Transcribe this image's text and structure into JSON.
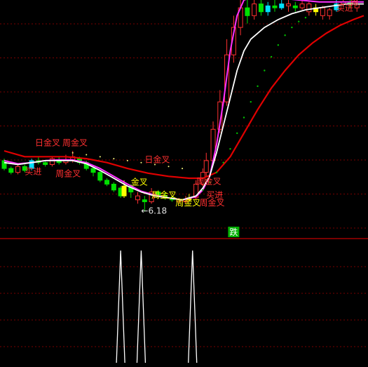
{
  "colors": {
    "background": "#000000",
    "grid": "#7a0000",
    "divider": "#c00000",
    "candle_up": "#ff3030",
    "candle_down": "#00e000",
    "candle_flat": "#ffff00",
    "candle_cyan": "#00e0ff",
    "ma_white": "#ffffff",
    "ma_magenta": "#ff30ff",
    "ma_red": "#e00000",
    "dots_green": "#00c000",
    "dots_yellow": "#ffff80",
    "label_red": "#ff3030",
    "label_yellow": "#ffff00",
    "label_white": "#e0e0e0",
    "badge_bg": "#00b000",
    "badge_text": "#ffffff",
    "spike": "#ffffff"
  },
  "chart_data": [
    {
      "type": "candlestick",
      "panel": "main",
      "y_range": [
        5.6,
        11.6
      ],
      "x_range": [
        0,
        105
      ],
      "grid": "dashed horizontal",
      "candles": [
        [
          0,
          7.5,
          7.3,
          7.55,
          7.25,
          "down"
        ],
        [
          2,
          7.3,
          7.2,
          7.35,
          7.15,
          "down"
        ],
        [
          4,
          7.2,
          7.35,
          7.4,
          7.15,
          "up"
        ],
        [
          6,
          7.35,
          7.25,
          7.4,
          7.2,
          "down"
        ],
        [
          8,
          7.3,
          7.5,
          7.55,
          7.25,
          "cyan"
        ],
        [
          10,
          7.5,
          7.45,
          7.6,
          7.4,
          "down"
        ],
        [
          12,
          7.45,
          7.4,
          7.5,
          7.35,
          "down"
        ],
        [
          14,
          7.4,
          7.55,
          7.6,
          7.35,
          "up"
        ],
        [
          16,
          7.5,
          7.45,
          7.6,
          7.4,
          "down"
        ],
        [
          18,
          7.45,
          7.5,
          7.65,
          7.4,
          "up"
        ],
        [
          20,
          7.5,
          7.6,
          7.75,
          7.45,
          "up"
        ],
        [
          22,
          7.55,
          7.45,
          7.6,
          7.4,
          "down"
        ],
        [
          24,
          7.45,
          7.3,
          7.5,
          7.25,
          "down"
        ],
        [
          26,
          7.3,
          7.2,
          7.35,
          7.1,
          "down"
        ],
        [
          28,
          7.2,
          7.0,
          7.25,
          6.95,
          "down"
        ],
        [
          30,
          7.0,
          6.9,
          7.05,
          6.85,
          "down"
        ],
        [
          32,
          6.9,
          6.75,
          6.95,
          6.7,
          "down"
        ],
        [
          34,
          6.8,
          6.6,
          6.85,
          6.55,
          "down"
        ],
        [
          35,
          6.6,
          6.85,
          7.0,
          6.55,
          "flat"
        ],
        [
          37,
          6.85,
          6.7,
          6.9,
          6.55,
          "down"
        ],
        [
          39,
          6.6,
          6.5,
          6.7,
          6.4,
          "up"
        ],
        [
          41,
          6.5,
          6.45,
          6.6,
          6.2,
          "down"
        ],
        [
          43,
          6.45,
          6.7,
          6.8,
          6.4,
          "up"
        ],
        [
          45,
          6.7,
          6.6,
          6.75,
          6.55,
          "down"
        ],
        [
          47,
          6.6,
          6.55,
          6.7,
          6.5,
          "down"
        ],
        [
          49,
          6.55,
          6.5,
          6.6,
          6.45,
          "down"
        ],
        [
          51,
          6.5,
          6.45,
          6.55,
          6.4,
          "up"
        ],
        [
          53,
          6.45,
          6.5,
          6.6,
          6.4,
          "up"
        ],
        [
          54,
          6.5,
          6.55,
          6.65,
          6.45,
          "flat"
        ],
        [
          56,
          6.55,
          6.9,
          7.0,
          6.5,
          "up"
        ],
        [
          58,
          6.9,
          7.2,
          7.3,
          6.85,
          "up"
        ],
        [
          59,
          7.2,
          7.5,
          7.7,
          7.1,
          "up"
        ],
        [
          61,
          7.5,
          8.3,
          8.5,
          7.4,
          "up"
        ],
        [
          63,
          8.3,
          9.0,
          9.3,
          8.2,
          "up"
        ],
        [
          65,
          9.0,
          10.2,
          10.6,
          8.9,
          "up"
        ],
        [
          67,
          10.2,
          10.9,
          11.2,
          10.0,
          "up"
        ],
        [
          69,
          10.9,
          11.4,
          11.8,
          10.7,
          "up"
        ],
        [
          71,
          11.4,
          11.2,
          11.6,
          11.0,
          "down"
        ],
        [
          73,
          11.2,
          11.5,
          11.7,
          11.1,
          "up"
        ],
        [
          75,
          11.5,
          11.3,
          11.6,
          11.2,
          "down"
        ],
        [
          77,
          11.3,
          11.45,
          11.55,
          11.2,
          "cyan"
        ],
        [
          79,
          11.45,
          11.4,
          11.6,
          11.3,
          "down"
        ],
        [
          81,
          11.4,
          11.5,
          11.6,
          11.35,
          "cyan"
        ],
        [
          83,
          11.5,
          11.45,
          11.6,
          11.3,
          "up"
        ],
        [
          85,
          11.45,
          11.4,
          11.55,
          11.3,
          "down"
        ],
        [
          87,
          11.4,
          11.5,
          11.6,
          11.35,
          "up"
        ],
        [
          89,
          11.5,
          11.3,
          11.55,
          11.2,
          "up"
        ],
        [
          91,
          11.3,
          11.4,
          11.5,
          11.2,
          "flat"
        ],
        [
          93,
          11.4,
          11.2,
          11.45,
          11.1,
          "up"
        ],
        [
          95,
          11.2,
          11.35,
          11.4,
          11.1,
          "up"
        ],
        [
          97,
          11.35,
          11.5,
          11.6,
          11.3,
          "cyan"
        ],
        [
          99,
          11.5,
          11.55,
          11.7,
          11.4,
          "up"
        ],
        [
          101,
          11.55,
          11.5,
          11.6,
          11.4,
          "down"
        ],
        [
          103,
          11.5,
          11.4,
          11.6,
          11.3,
          "up"
        ]
      ],
      "ma_white": [
        [
          0,
          7.45
        ],
        [
          4,
          7.4
        ],
        [
          8,
          7.45
        ],
        [
          12,
          7.5
        ],
        [
          16,
          7.5
        ],
        [
          20,
          7.5
        ],
        [
          24,
          7.42
        ],
        [
          28,
          7.25
        ],
        [
          32,
          7.05
        ],
        [
          36,
          6.85
        ],
        [
          40,
          6.7
        ],
        [
          44,
          6.6
        ],
        [
          48,
          6.55
        ],
        [
          52,
          6.5
        ],
        [
          56,
          6.6
        ],
        [
          58,
          6.8
        ],
        [
          60,
          7.1
        ],
        [
          62,
          7.7
        ],
        [
          64,
          8.4
        ],
        [
          66,
          9.1
        ],
        [
          68,
          9.8
        ],
        [
          70,
          10.3
        ],
        [
          72,
          10.6
        ],
        [
          76,
          10.9
        ],
        [
          80,
          11.1
        ],
        [
          84,
          11.25
        ],
        [
          88,
          11.35
        ],
        [
          92,
          11.4
        ],
        [
          96,
          11.45
        ],
        [
          100,
          11.5
        ],
        [
          105,
          11.5
        ]
      ],
      "ma_magenta": [
        [
          0,
          7.5
        ],
        [
          4,
          7.42
        ],
        [
          8,
          7.45
        ],
        [
          12,
          7.5
        ],
        [
          16,
          7.52
        ],
        [
          20,
          7.52
        ],
        [
          24,
          7.45
        ],
        [
          28,
          7.3
        ],
        [
          32,
          7.1
        ],
        [
          36,
          6.9
        ],
        [
          40,
          6.72
        ],
        [
          44,
          6.62
        ],
        [
          48,
          6.55
        ],
        [
          52,
          6.5
        ],
        [
          56,
          6.58
        ],
        [
          58,
          6.75
        ],
        [
          60,
          7.1
        ],
        [
          62,
          7.9
        ],
        [
          64,
          9.0
        ],
        [
          66,
          10.3
        ],
        [
          68,
          11.2
        ],
        [
          70,
          11.6
        ],
        [
          74,
          11.7
        ],
        [
          80,
          11.65
        ],
        [
          86,
          11.6
        ],
        [
          92,
          11.55
        ],
        [
          98,
          11.55
        ],
        [
          105,
          11.55
        ]
      ],
      "ma_red": [
        [
          0,
          7.75
        ],
        [
          6,
          7.6
        ],
        [
          12,
          7.6
        ],
        [
          18,
          7.6
        ],
        [
          24,
          7.55
        ],
        [
          30,
          7.45
        ],
        [
          36,
          7.3
        ],
        [
          42,
          7.18
        ],
        [
          48,
          7.1
        ],
        [
          54,
          7.05
        ],
        [
          58,
          7.05
        ],
        [
          62,
          7.2
        ],
        [
          66,
          7.6
        ],
        [
          70,
          8.2
        ],
        [
          74,
          8.8
        ],
        [
          78,
          9.35
        ],
        [
          82,
          9.8
        ],
        [
          86,
          10.2
        ],
        [
          90,
          10.5
        ],
        [
          94,
          10.75
        ],
        [
          98,
          10.95
        ],
        [
          102,
          11.1
        ],
        [
          105,
          11.2
        ]
      ],
      "dots_green": [
        [
          58,
          6.75
        ],
        [
          60,
          6.95
        ],
        [
          62,
          7.2
        ],
        [
          64,
          7.45
        ],
        [
          66,
          7.8
        ],
        [
          68,
          8.2
        ],
        [
          70,
          8.6
        ],
        [
          72,
          9.0
        ],
        [
          74,
          9.4
        ],
        [
          76,
          9.8
        ],
        [
          78,
          10.15
        ],
        [
          80,
          10.45
        ],
        [
          82,
          10.7
        ],
        [
          84,
          10.9
        ],
        [
          86,
          11.05
        ],
        [
          88,
          11.15
        ]
      ],
      "dots_yellow": [
        [
          20,
          7.7
        ],
        [
          24,
          7.65
        ],
        [
          28,
          7.6
        ],
        [
          32,
          7.55
        ],
        [
          36,
          7.5
        ],
        [
          40,
          7.45
        ],
        [
          44,
          7.4
        ],
        [
          48,
          7.35
        ],
        [
          52,
          7.3
        ]
      ],
      "annotations": [
        {
          "text": "日金叉",
          "x": 9,
          "y": 7.88,
          "color": "red"
        },
        {
          "text": "周金叉",
          "x": 17,
          "y": 7.88,
          "color": "red"
        },
        {
          "text": "买进",
          "x": 6,
          "y": 7.15,
          "color": "red"
        },
        {
          "text": "周金叉",
          "x": 15,
          "y": 7.1,
          "color": "red"
        },
        {
          "text": "日金叉",
          "x": 41,
          "y": 7.45,
          "color": "red"
        },
        {
          "text": "金叉",
          "x": 37,
          "y": 6.88,
          "color": "yellow"
        },
        {
          "text": "周金叉",
          "x": 43,
          "y": 6.55,
          "color": "yellow"
        },
        {
          "text": "周金叉",
          "x": 50,
          "y": 6.35,
          "color": "yellow"
        },
        {
          "text": "周金叉",
          "x": 56,
          "y": 6.9,
          "color": "red"
        },
        {
          "text": "买进",
          "x": 59,
          "y": 6.55,
          "color": "red"
        },
        {
          "text": "周金叉",
          "x": 57,
          "y": 6.35,
          "color": "red"
        },
        {
          "text": "←6.18",
          "x": 40,
          "y": 6.15,
          "color": "white"
        },
        {
          "text": "周",
          "x": 101,
          "y": 11.48,
          "color": "red"
        },
        {
          "text": "买进",
          "x": 97,
          "y": 11.32,
          "color": "red"
        }
      ],
      "badge": {
        "text": "跌",
        "x": 67
      }
    },
    {
      "type": "spikes",
      "panel": "sub",
      "y_range": [
        0,
        1
      ],
      "x": [
        34,
        40,
        55
      ],
      "values": [
        1,
        1,
        1
      ]
    }
  ]
}
